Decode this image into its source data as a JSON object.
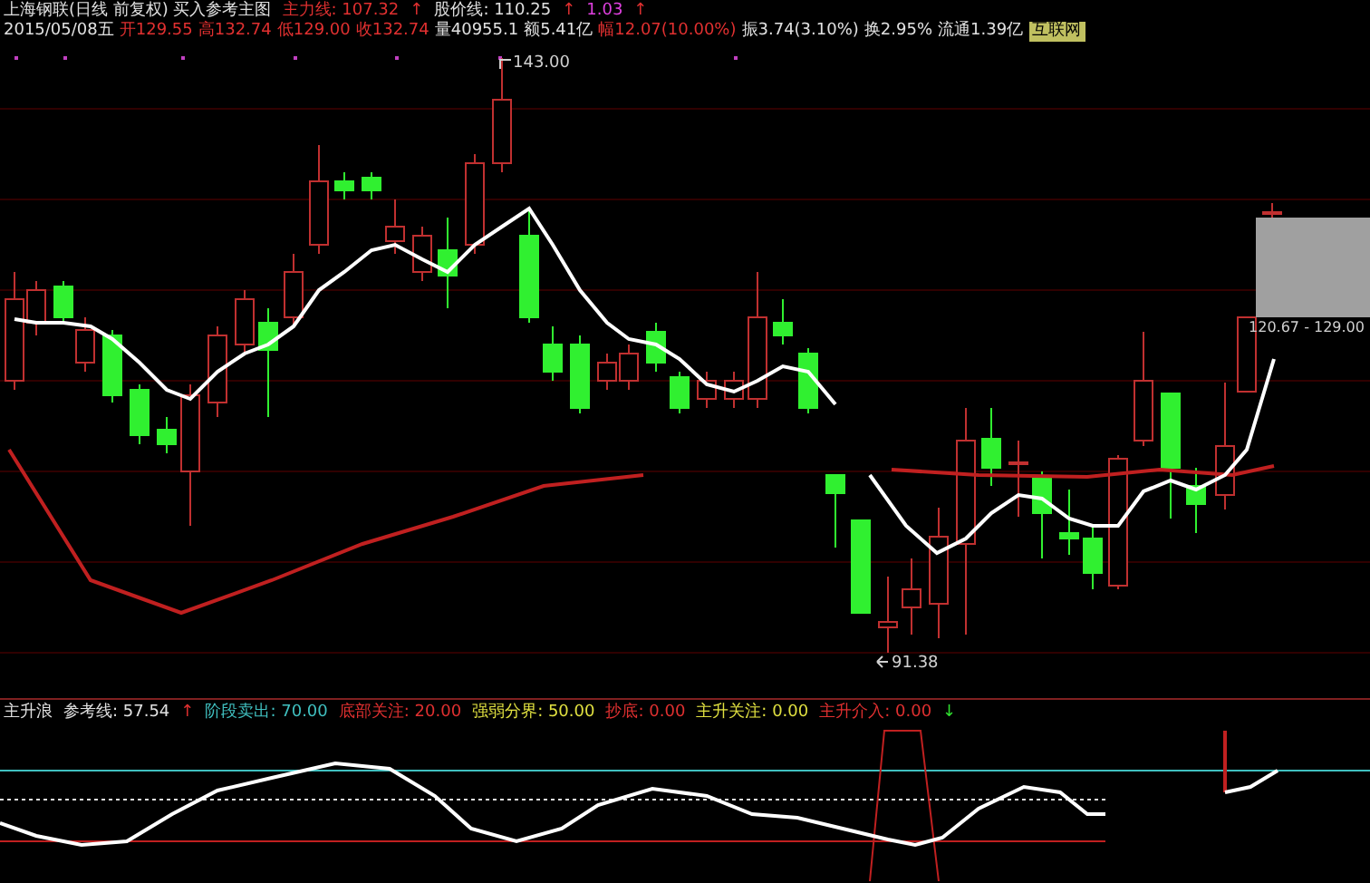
{
  "header": {
    "line_1": [
      {
        "text": "上海钢联(日线 前复权) 买入参考主图",
        "color": "#e0e0e0"
      },
      {
        "text": "主力线: 107.32",
        "color": "#e03030"
      },
      {
        "text": "↑",
        "color": "#e03030"
      },
      {
        "text": "股价线: 110.25",
        "color": "#e0e0e0"
      },
      {
        "text": "↑",
        "color": "#e03030"
      },
      {
        "text": "1.03",
        "color": "#e040e0"
      },
      {
        "text": "↑",
        "color": "#e03030"
      }
    ],
    "line_2": [
      {
        "text": "2015/05/08五",
        "color": "#e0e0e0"
      },
      {
        "text": "开129.55",
        "color": "#e03030"
      },
      {
        "text": "高132.74",
        "color": "#e03030"
      },
      {
        "text": "低129.00",
        "color": "#e03030"
      },
      {
        "text": "收132.74",
        "color": "#e03030"
      },
      {
        "text": "量40955.1",
        "color": "#e0e0e0"
      },
      {
        "text": "额5.41亿",
        "color": "#e0e0e0"
      },
      {
        "text": "幅12.07(10.00%)",
        "color": "#e03030"
      },
      {
        "text": "振3.74(3.10%)",
        "color": "#e0e0e0"
      },
      {
        "text": "换2.95%",
        "color": "#e0e0e0"
      },
      {
        "text": "流通1.39亿",
        "color": "#e0e0e0"
      }
    ],
    "sector_tag": "互联网"
  },
  "chart": {
    "high_label": "143.00",
    "low_label": "91.38",
    "range_label": "120.67 - 129.00"
  },
  "indicator": {
    "legend": [
      {
        "text": "主升浪",
        "color": "#e0e0e0"
      },
      {
        "text": "参考线: 57.54",
        "color": "#e0e0e0"
      },
      {
        "text": "↑",
        "color": "#e03030"
      },
      {
        "text": "阶段卖出: 70.00",
        "color": "#40c0c0"
      },
      {
        "text": "底部关注: 20.00",
        "color": "#e03030"
      },
      {
        "text": "强弱分界: 50.00",
        "color": "#e0e040"
      },
      {
        "text": "抄底: 0.00",
        "color": "#e03030"
      },
      {
        "text": "主升关注: 0.00",
        "color": "#e0e040"
      },
      {
        "text": "主升介入: 0.00",
        "color": "#e03030"
      },
      {
        "text": "↓",
        "color": "#30e030"
      }
    ]
  }
}
